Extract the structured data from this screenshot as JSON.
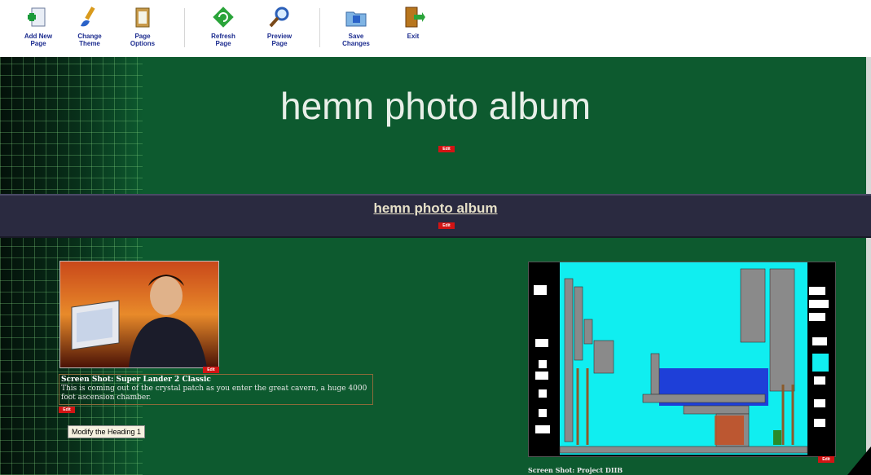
{
  "toolbar": {
    "buttons": [
      {
        "label_line1": "Add New",
        "label_line2": "Page",
        "icon": "add-page-icon"
      },
      {
        "label_line1": "Change",
        "label_line2": "Theme",
        "icon": "paintbrush-icon"
      },
      {
        "label_line1": "Page",
        "label_line2": "Options",
        "icon": "clipboard-icon"
      },
      {
        "label_line1": "Refresh",
        "label_line2": "Page",
        "icon": "refresh-icon"
      },
      {
        "label_line1": "Preview",
        "label_line2": "Page",
        "icon": "magnifier-icon"
      },
      {
        "label_line1": "Save",
        "label_line2": "Changes",
        "icon": "save-folder-icon"
      },
      {
        "label_line1": "Exit",
        "label_line2": "",
        "icon": "exit-door-icon"
      }
    ]
  },
  "site": {
    "title": "hemn photo album",
    "nav_link": "hemn photo album",
    "edit_label": "Edit"
  },
  "photos": [
    {
      "caption_title": "Screen Shot: Super Lander 2 Classic",
      "caption_text": "This is coming out of the crystal patch as you enter the great cavern, a huge 4000 foot ascension chamber."
    },
    {
      "caption_title": "Screen Shot: Project DIIB"
    }
  ],
  "modify_heading_label": "Modify the Heading 1"
}
